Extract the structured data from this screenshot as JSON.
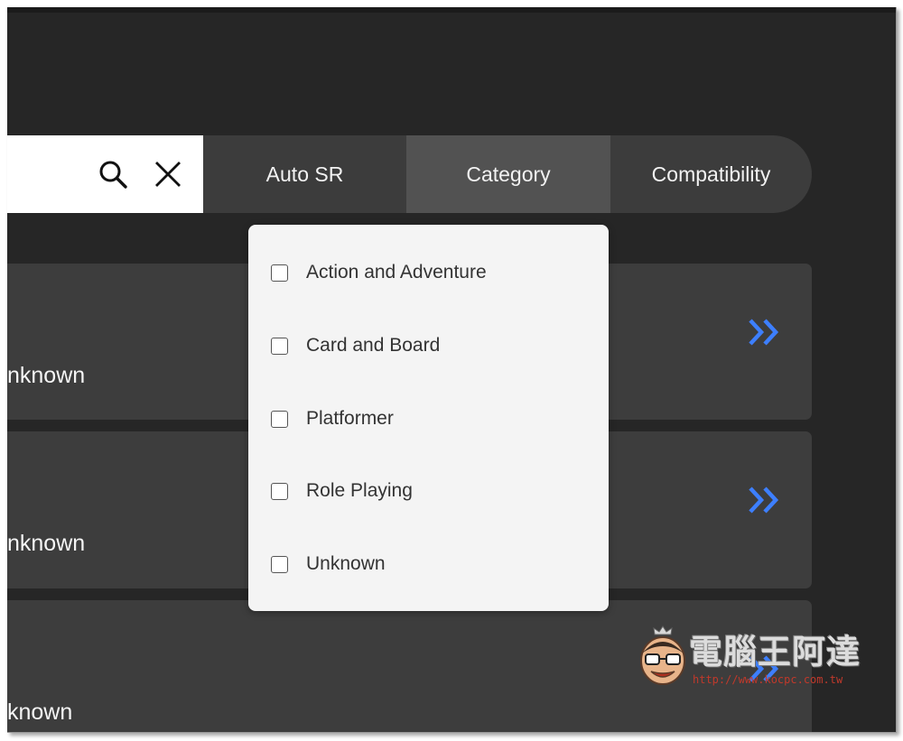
{
  "search": {
    "value": "",
    "placeholder": ""
  },
  "toolbar": {
    "tabs": [
      {
        "label": "Auto SR"
      },
      {
        "label": "Category"
      },
      {
        "label": "Compatibility"
      }
    ]
  },
  "cards": [
    {
      "value": "nknown"
    },
    {
      "value": "nknown"
    },
    {
      "value": "known"
    }
  ],
  "dropdown": {
    "options": [
      {
        "label": "Action and Adventure",
        "checked": false
      },
      {
        "label": "Card and Board",
        "checked": false
      },
      {
        "label": "Platformer",
        "checked": false
      },
      {
        "label": "Role Playing",
        "checked": false
      },
      {
        "label": "Unknown",
        "checked": false
      }
    ]
  },
  "watermark": {
    "title": "電腦王阿達",
    "url": "http://www.kocpc.com.tw"
  },
  "colors": {
    "chevron": "#3d7fff",
    "background": "#262626",
    "card": "#3d3d3d",
    "dropdown": "#f4f4f4"
  },
  "icons": [
    "search-icon",
    "close-icon",
    "double-chevron-right-icon",
    "checkbox-icon"
  ]
}
